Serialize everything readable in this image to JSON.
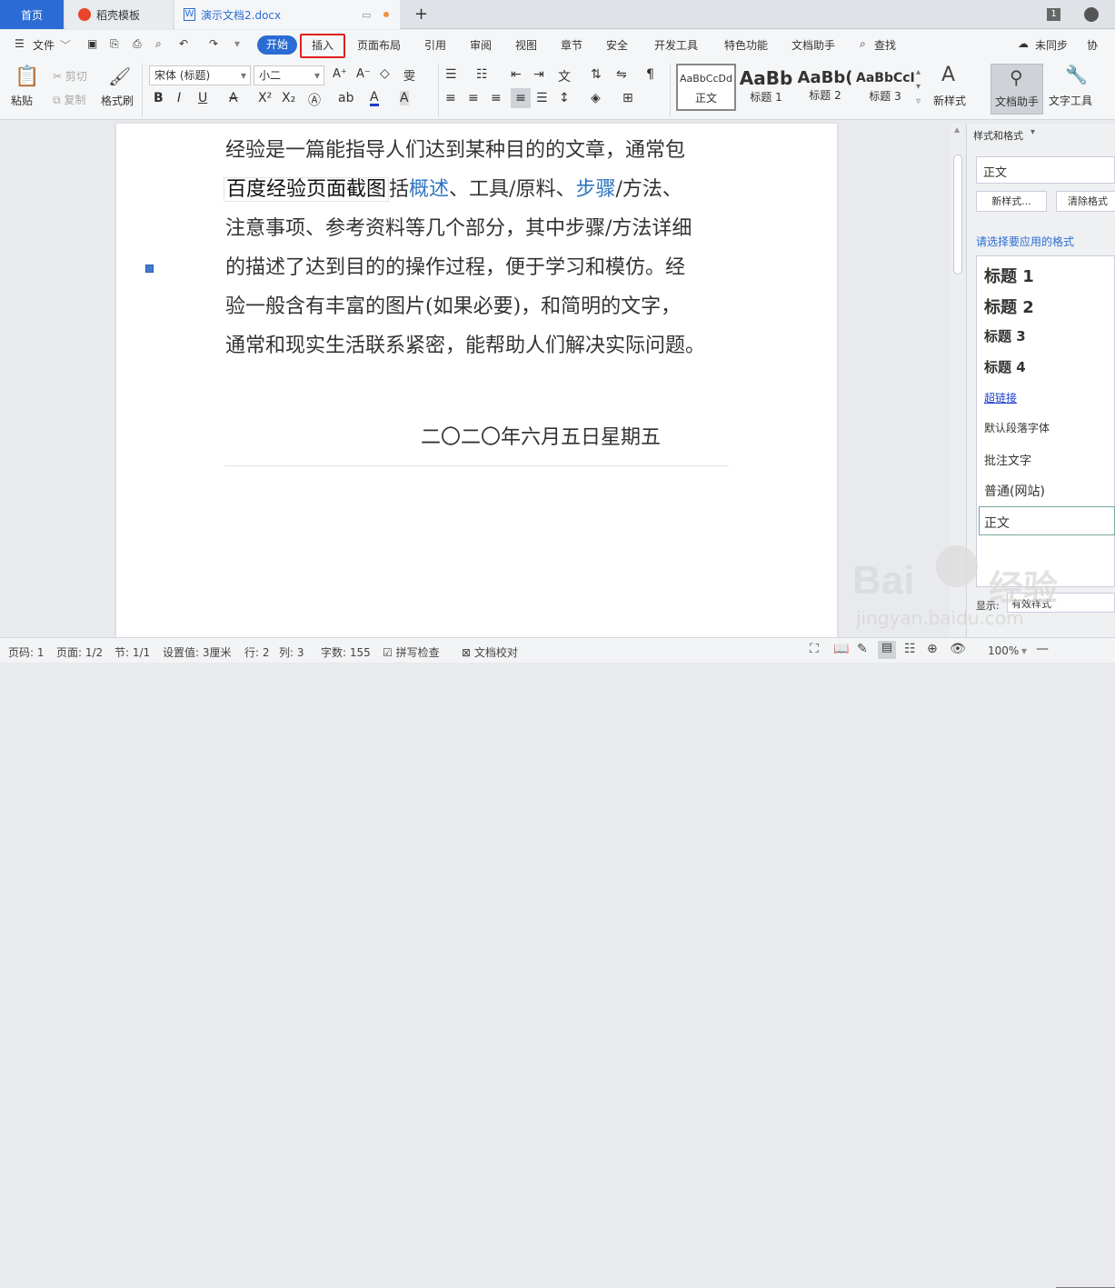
{
  "tabs": {
    "home": "首页",
    "template": "稻壳模板",
    "doc": "演示文档2.docx",
    "badge": "1"
  },
  "menu": {
    "file": "文件",
    "start": "开始",
    "insert": "插入",
    "layout": "页面布局",
    "reference": "引用",
    "review": "审阅",
    "view": "视图",
    "section": "章节",
    "security": "安全",
    "dev": "开发工具",
    "features": "特色功能",
    "assistant": "文档助手",
    "find": "查找",
    "sync": "未同步",
    "collab": "协"
  },
  "ribbon": {
    "paste": "粘贴",
    "cut": "剪切",
    "copy": "复制",
    "format_painter": "格式刷",
    "font": "宋体 (标题)",
    "size": "小二",
    "new_style": "新样式",
    "doc_assistant": "文档助手",
    "text_tools": "文字工具",
    "styles": [
      {
        "preview": "AaBbCcDd",
        "label": "正文"
      },
      {
        "preview": "AaBb",
        "label": "标题 1"
      },
      {
        "preview": "AaBb(",
        "label": "标题 2"
      },
      {
        "preview": "AaBbCcI",
        "label": "标题 3"
      }
    ]
  },
  "document": {
    "lines": [
      "经验是一篇能指导人们达到某种目的的文章，通常包",
      "括",
      "、工具/原料、",
      "/方法、",
      "注意事项、参考资料等几个部分，其中步骤/方法详细",
      "的描述了达到目的的操作过程，便于学习和模仿。经",
      "验一般含有丰富的图片(如果必要)，和简明的文字，",
      "通常和现实生活联系紧密，能帮助人们解决实际问题。"
    ],
    "overlay": "百度经验页面截图",
    "link1": "概述",
    "link2": "步骤",
    "date": "二〇二〇年六月五日星期五"
  },
  "panel": {
    "title": "样式和格式",
    "current": "正文",
    "new_btn": "新样式...",
    "clear_btn": "清除格式",
    "prompt": "请选择要应用的格式",
    "items": [
      "标题 1",
      "标题 2",
      "标题 3",
      "标题 4",
      "超链接",
      "默认段落字体",
      "批注文字",
      "普通(网站)",
      "正文"
    ],
    "show_label": "显示:",
    "show_value": "有效样式"
  },
  "status": {
    "page_no": "页码: 1",
    "pages": "页面: 1/2",
    "section": "节: 1/1",
    "setting": "设置值: 3厘米",
    "row": "行: 2",
    "col": "列: 3",
    "words": "字数: 155",
    "spell": "拼写检查",
    "proof": "文档校对",
    "zoom": "100%"
  },
  "watermark": {
    "brand": "Bai",
    "brand2": "经验",
    "url": "jingyan.baidu.com"
  },
  "colors": {
    "accent": "#2b6cd4",
    "highlight_border": "#e02020",
    "link": "#2e74c0"
  }
}
